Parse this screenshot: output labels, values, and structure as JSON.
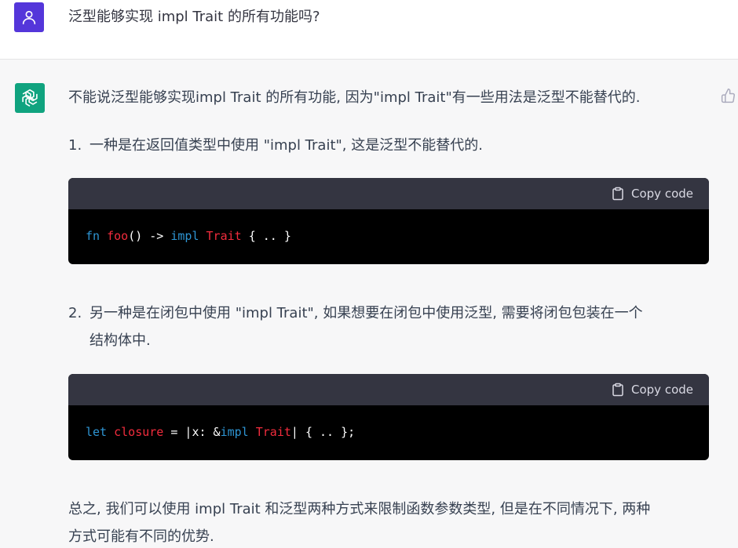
{
  "user": {
    "question": "泛型能够实现 impl Trait 的所有功能吗?"
  },
  "assistant": {
    "intro": "不能说泛型能够实现impl Trait 的所有功能, 因为\"impl Trait\"有一些用法是泛型不能替代的.",
    "items": [
      {
        "number": "1.",
        "text": "一种是在返回值类型中使用 \"impl Trait\", 这是泛型不能替代的."
      },
      {
        "number": "2.",
        "text_line1": "另一种是在闭包中使用 \"impl Trait\", 如果想要在闭包中使用泛型, 需要将闭包包装在一个",
        "text_line2": "结构体中."
      }
    ],
    "code_blocks": [
      {
        "copy_label": "Copy code",
        "tokens": {
          "t1": "fn",
          "t2": " ",
          "t3": "foo",
          "t4": "() -> ",
          "t5": "impl",
          "t6": " ",
          "t7": "Trait",
          "t8": " { .. }"
        }
      },
      {
        "copy_label": "Copy code",
        "tokens": {
          "t1": "let",
          "t2": " ",
          "t3": "closure",
          "t4": " = |x: &",
          "t5": "impl",
          "t6": " ",
          "t7": "Trait",
          "t8": "| { .. };"
        }
      }
    ],
    "conclusion_line1": "总之, 我们可以使用 impl Trait 和泛型两种方式来限制函数参数类型, 但是在不同情况下, 两种",
    "conclusion_line2": "方式可能有不同的优势."
  },
  "colors": {
    "user_avatar": "#5436da",
    "bot_avatar": "#10a37f",
    "code_keyword": "#2e95d3",
    "code_function": "#f22c3d"
  },
  "icons": {
    "user_avatar": "person-icon",
    "bot_avatar": "openai-logo-icon",
    "copy": "clipboard-icon",
    "feedback": "thumbs-up-icon"
  }
}
